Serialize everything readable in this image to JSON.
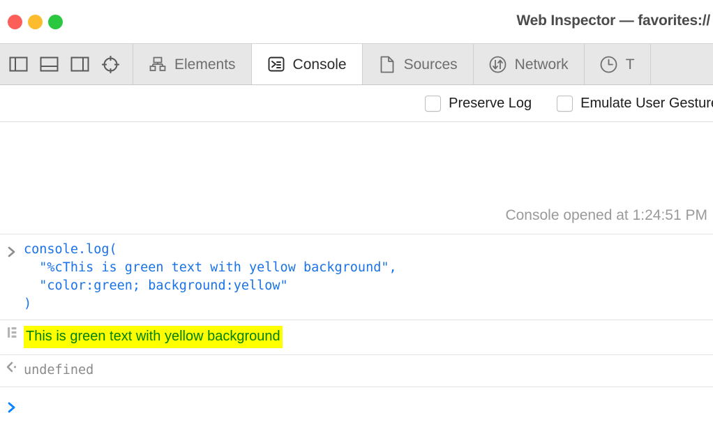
{
  "window": {
    "title": "Web Inspector — favorites://",
    "controls": [
      {
        "name": "close",
        "color": "#fc5f57"
      },
      {
        "name": "minimize",
        "color": "#fdbc2e"
      },
      {
        "name": "maximize",
        "color": "#2bc740"
      }
    ]
  },
  "layout_buttons": [
    {
      "name": "dock-left",
      "label": "Dock to Left"
    },
    {
      "name": "dock-bottom",
      "label": "Dock to Bottom"
    },
    {
      "name": "dock-right",
      "label": "Dock to Right"
    },
    {
      "name": "inspect-element",
      "label": "Select Element"
    }
  ],
  "tabs": [
    {
      "label": "Elements",
      "icon": "dom-tree-icon",
      "active": false
    },
    {
      "label": "Console",
      "icon": "console-prompt-icon",
      "active": true
    },
    {
      "label": "Sources",
      "icon": "document-icon",
      "active": false
    },
    {
      "label": "Network",
      "icon": "network-arrows-icon",
      "active": false
    },
    {
      "label": "T",
      "icon": "clock-icon",
      "active": false
    }
  ],
  "options": [
    {
      "label": "Preserve Log",
      "checked": false
    },
    {
      "label": "Emulate User Gesture",
      "checked": false
    }
  ],
  "console": {
    "opened_message": "Console opened at 1:24:51 PM",
    "input_code": "console.log(\n  \"%cThis is green text with yellow background\",\n  \"color:green; background:yellow\"\n)",
    "log_output": "This is green text with yellow background",
    "log_output_color": "#008000",
    "log_output_background": "#ffff00",
    "result_value": "undefined",
    "prompt_value": ""
  }
}
